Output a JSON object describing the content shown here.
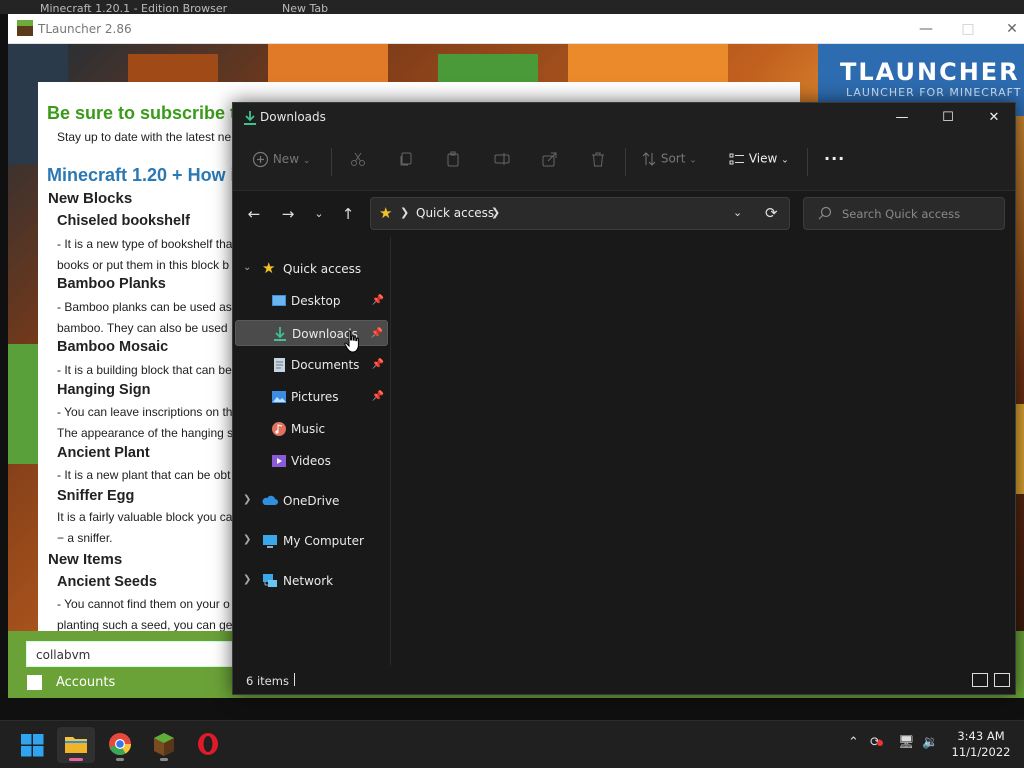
{
  "background_tabs": [
    "Minecraft 1.20.1 - Edition Browser",
    "New Tab"
  ],
  "tlauncher": {
    "title": "TLauncher 2.86",
    "logo_title": "TLAUNCHER",
    "logo_subtitle": "LAUNCHER FOR MINECRAFT",
    "news": {
      "subscribe_heading": "Be sure to subscribe to",
      "subscribe_text": "Stay up to date with the latest ne",
      "article_title": "Minecraft 1.20 + How i",
      "sections": [
        {
          "heading": "New Blocks"
        },
        {
          "subheading": "Chiseled bookshelf",
          "lines": [
            "- It is a new type of bookshelf tha",
            "books or put them in this block b"
          ]
        },
        {
          "subheading": "Bamboo Planks",
          "lines": [
            "- Bamboo planks can be used as",
            "bamboo. They can also be used"
          ]
        },
        {
          "subheading": "Bamboo Mosaic",
          "lines": [
            "- It is a building block that can be"
          ]
        },
        {
          "subheading": "Hanging Sign",
          "lines": [
            "- You can leave inscriptions on th",
            "The appearance of the hanging s"
          ]
        },
        {
          "subheading": "Ancient Plant",
          "lines": [
            "- It is a new plant that can be obt"
          ]
        },
        {
          "subheading": "Sniffer Egg",
          "lines": [
            "It is a fairly valuable block you ca",
            "− a sniffer."
          ]
        },
        {
          "heading": "New Items"
        },
        {
          "subheading": "Ancient Seeds",
          "lines": [
            "- You cannot find them on your o",
            "planting such a seed, you can ge"
          ]
        }
      ]
    },
    "username": "collabvm",
    "accounts_label": "Accounts"
  },
  "explorer": {
    "title": "Downloads",
    "toolbar": {
      "new_label": "New",
      "sort_label": "Sort",
      "view_label": "View",
      "more_label": "..."
    },
    "address": {
      "location": "Quick access"
    },
    "search": {
      "placeholder": "Search Quick access"
    },
    "sidebar": {
      "quick_access": "Quick access",
      "items": [
        {
          "label": "Desktop",
          "icon": "desktop-icon",
          "pinned": true
        },
        {
          "label": "Downloads",
          "icon": "download-icon",
          "pinned": true,
          "selected": true
        },
        {
          "label": "Documents",
          "icon": "document-icon",
          "pinned": true
        },
        {
          "label": "Pictures",
          "icon": "pictures-icon",
          "pinned": true
        },
        {
          "label": "Music",
          "icon": "music-icon",
          "pinned": false
        },
        {
          "label": "Videos",
          "icon": "videos-icon",
          "pinned": false
        }
      ],
      "onedrive": "OneDrive",
      "my_computer": "My Computer",
      "network": "Network"
    },
    "status": {
      "item_count": "6 items"
    }
  },
  "taskbar": {
    "apps": [
      "Start",
      "File Explorer",
      "Google Chrome",
      "TLauncher",
      "Opera"
    ],
    "clock": {
      "time": "3:43 AM",
      "date": "11/1/2022"
    }
  },
  "colors": {
    "accent_green": "#3a9a1a",
    "accent_blue": "#2a78b4",
    "explorer_bg": "#191919",
    "star": "#f3c12c"
  }
}
